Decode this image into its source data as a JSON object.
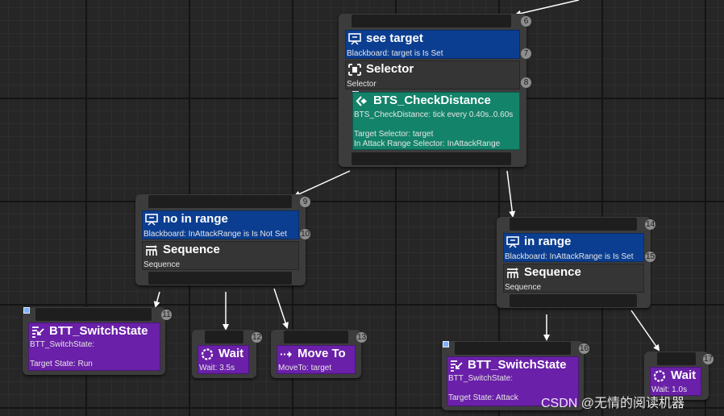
{
  "nodes": {
    "root_selector": {
      "index": "6",
      "decorator": {
        "title": "see target",
        "subtitle": "Blackboard: target is Is Set",
        "index": "7"
      },
      "composite": {
        "title": "Selector",
        "subtitle": "Selector",
        "index": "8"
      },
      "service": {
        "title": "BTS_CheckDistance",
        "line1": "BTS_CheckDistance: tick every 0.40s..0.60s",
        "line2": "Target Selector: target",
        "line3": "In Attack Range Selector: InAttackRange"
      }
    },
    "left_sequence": {
      "index": "9",
      "decorator": {
        "title": "no in range",
        "subtitle": "Blackboard: InAttackRange is Is Not Set",
        "index": "10"
      },
      "composite": {
        "title": "Sequence",
        "subtitle": "Sequence"
      }
    },
    "right_sequence": {
      "index": "14",
      "decorator": {
        "title": "in range",
        "subtitle": "Blackboard: InAttackRange is Is Set",
        "index": "15"
      },
      "composite": {
        "title": "Sequence",
        "subtitle": "Sequence"
      }
    },
    "switch_run": {
      "index": "11",
      "title": "BTT_SwitchState",
      "line1": "BTT_SwitchState:",
      "line2": "Target State: Run"
    },
    "wait_left": {
      "index": "12",
      "title": "Wait",
      "line1": "Wait: 3.5s"
    },
    "move_to": {
      "index": "13",
      "title": "Move To",
      "line1": "MoveTo: target"
    },
    "switch_attack": {
      "index": "16",
      "title": "BTT_SwitchState",
      "line1": "BTT_SwitchState:",
      "line2": "Target State: Attack"
    },
    "wait_right": {
      "index": "17",
      "title": "Wait",
      "line1": "Wait: 1.0s"
    }
  },
  "watermark": "CSDN @无情的阅读机器",
  "colors": {
    "decorator": "#0b3e91",
    "service": "#13836a",
    "task": "#6a20a8",
    "composite": "#353535",
    "node_frame": "#3c3c3c",
    "background": "#262626"
  },
  "icons": {
    "decorator": "monitor-icon",
    "selector": "selector-icon",
    "sequence": "sequence-icon",
    "service": "service-icon",
    "switch_state": "task-list-icon",
    "wait": "wait-icon",
    "move_to": "move-to-icon"
  }
}
